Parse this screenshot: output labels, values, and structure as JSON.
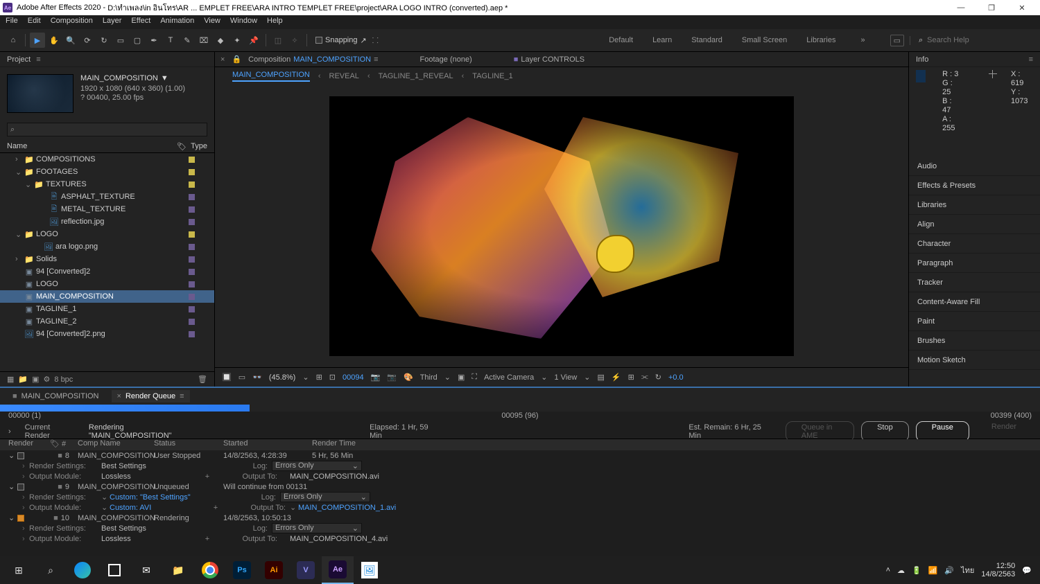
{
  "titlebar": {
    "app": "Adobe After Effects 2020",
    "path": "D:\\ทำเพลง\\in อินโทร\\AR ... EMPLET FREE\\ARA INTRO TEMPLET FREE\\project\\ARA LOGO INTRO (converted).aep *"
  },
  "menubar": [
    "File",
    "Edit",
    "Composition",
    "Layer",
    "Effect",
    "Animation",
    "View",
    "Window",
    "Help"
  ],
  "toolbar": {
    "snapping": "Snapping"
  },
  "workspaces": [
    "Default",
    "Learn",
    "Standard",
    "Small Screen",
    "Libraries"
  ],
  "search_placeholder": "Search Help",
  "project": {
    "panel_title": "Project",
    "comp": {
      "name": "MAIN_COMPOSITION",
      "resolution": "1920 x 1080  (640 x 360) (1.00)",
      "duration": "? 00400, 25.00 fps"
    },
    "columns": {
      "name": "Name",
      "type": "Type"
    },
    "tree": [
      {
        "indent": 1,
        "type": "folder",
        "toggle": ">",
        "label": "COMPOSITIONS",
        "swatch": "yellow"
      },
      {
        "indent": 1,
        "type": "folder",
        "toggle": "v",
        "label": "FOOTAGES",
        "swatch": "yellow"
      },
      {
        "indent": 2,
        "type": "folder",
        "toggle": "v",
        "label": "TEXTURES",
        "swatch": "yellow"
      },
      {
        "indent": 4,
        "type": "file",
        "toggle": "",
        "label": "ASPHALT_TEXTURE",
        "swatch": "violet"
      },
      {
        "indent": 4,
        "type": "file",
        "toggle": "",
        "label": "METAL_TEXTURE",
        "swatch": "violet"
      },
      {
        "indent": 4,
        "type": "img",
        "toggle": "",
        "label": "reflection.jpg",
        "swatch": "violet"
      },
      {
        "indent": 1,
        "type": "folder",
        "toggle": "v",
        "label": "LOGO",
        "swatch": "yellow"
      },
      {
        "indent": 3,
        "type": "img",
        "toggle": "",
        "label": "ara logo.png",
        "swatch": "violet"
      },
      {
        "indent": 1,
        "type": "folder",
        "toggle": ">",
        "label": "Solids",
        "swatch": "violet"
      },
      {
        "indent": 1,
        "type": "comp",
        "toggle": "",
        "label": "94 [Converted]2",
        "swatch": "violet"
      },
      {
        "indent": 1,
        "type": "comp",
        "toggle": "",
        "label": "LOGO",
        "swatch": "violet"
      },
      {
        "indent": 1,
        "type": "comp",
        "toggle": "",
        "label": "MAIN_COMPOSITION",
        "swatch": "violet",
        "selected": true
      },
      {
        "indent": 1,
        "type": "comp",
        "toggle": "",
        "label": "TAGLINE_1",
        "swatch": "violet"
      },
      {
        "indent": 1,
        "type": "comp",
        "toggle": "",
        "label": "TAGLINE_2",
        "swatch": "violet"
      },
      {
        "indent": 1,
        "type": "img",
        "toggle": "",
        "label": "94 [Converted]2.png",
        "swatch": "violet"
      }
    ],
    "footer": {
      "bpc": "8 bpc"
    }
  },
  "composition": {
    "tab_label": "Composition",
    "tab_comp": "MAIN_COMPOSITION",
    "footage": "Footage  (none)",
    "layer": "Layer  CONTROLS",
    "breadcrumb": [
      "MAIN_COMPOSITION",
      "REVEAL",
      "TAGLINE_1_REVEAL",
      "TAGLINE_1"
    ]
  },
  "viewer": {
    "zoom": "(45.8%)",
    "frame": "00094",
    "quality": "Third",
    "camera": "Active Camera",
    "views": "1 View",
    "exposure": "+0.0"
  },
  "info": {
    "title": "Info",
    "r": "R : 3",
    "g": "G : 25",
    "b": "B : 47",
    "a": "A : 255",
    "x": "X : 619",
    "y": "Y : 1073"
  },
  "right_panels": [
    "Audio",
    "Effects & Presets",
    "Libraries",
    "Align",
    "Character",
    "Paragraph",
    "Tracker",
    "Content-Aware Fill",
    "Paint",
    "Brushes",
    "Motion Sketch"
  ],
  "render_queue": {
    "tab1": "MAIN_COMPOSITION",
    "tab2": "Render Queue",
    "left_time": "00000 (1)",
    "mid_time": "00095 (96)",
    "right_time": "00399 (400)",
    "current": "Current Render",
    "rendering": "Rendering \"MAIN_COMPOSITION\"",
    "elapsed_lbl": "Elapsed:",
    "elapsed": "1 Hr, 59 Min",
    "remain_lbl": "Est. Remain:",
    "remain": "6 Hr, 25 Min",
    "queue_ame": "Queue in AME",
    "stop": "Stop",
    "pause": "Pause",
    "render": "Render",
    "headers": {
      "render": "Render",
      "num": "#",
      "comp": "Comp Name",
      "status": "Status",
      "started": "Started",
      "rtime": "Render Time"
    },
    "items": [
      {
        "num": "8",
        "comp": "MAIN_COMPOSITION",
        "status": "User Stopped",
        "started": "14/8/2563, 4:28:39",
        "rtime": "5 Hr, 56 Min",
        "rs_label": "Render Settings:",
        "rs_val": "Best Settings",
        "om_label": "Output Module:",
        "om_val": "Lossless",
        "log_label": "Log:",
        "log_val": "Errors Only",
        "ot_label": "Output To:",
        "ot_val": "MAIN_COMPOSITION.avi",
        "checked": false
      },
      {
        "num": "9",
        "comp": "MAIN_COMPOSITION",
        "status": "Unqueued",
        "started": "Will continue from 00131",
        "rtime": "",
        "rs_label": "Render Settings:",
        "rs_val": "Custom: \"Best Settings\"",
        "om_label": "Output Module:",
        "om_val": "Custom: AVI",
        "log_label": "Log:",
        "log_val": "Errors Only",
        "ot_label": "Output To:",
        "ot_val": "MAIN_COMPOSITION_1.avi",
        "link": true,
        "checked": false
      },
      {
        "num": "10",
        "comp": "MAIN_COMPOSITION",
        "status": "Rendering",
        "started": "14/8/2563, 10:50:13",
        "rtime": "",
        "rs_label": "Render Settings:",
        "rs_val": "Best Settings",
        "om_label": "Output Module:",
        "om_val": "Lossless",
        "log_label": "Log:",
        "log_val": "Errors Only",
        "ot_label": "Output To:",
        "ot_val": "MAIN_COMPOSITION_4.avi",
        "checked": true,
        "orange": true
      }
    ]
  },
  "taskbar": {
    "lang": "ไทย",
    "time": "12:50",
    "date": "14/8/2563"
  }
}
